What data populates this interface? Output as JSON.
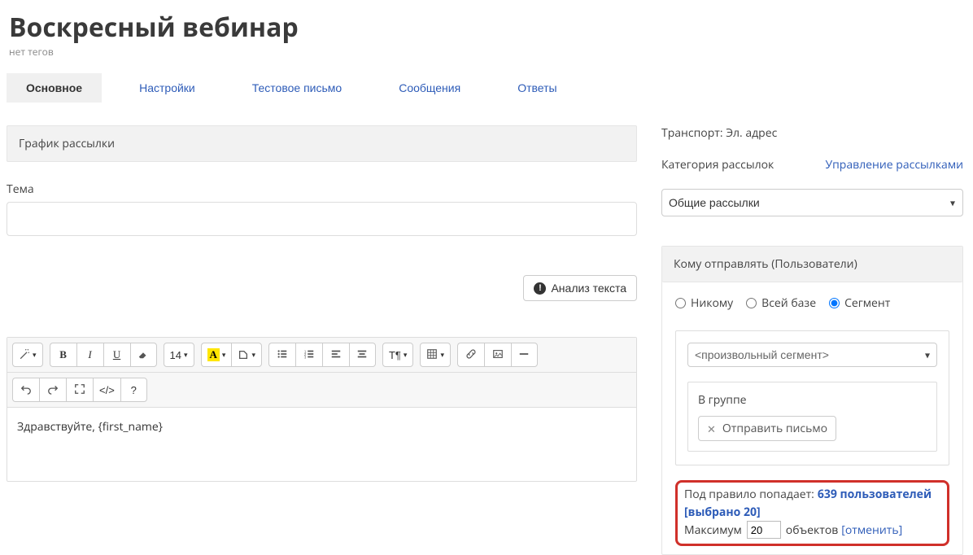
{
  "title": "Воскресный вебинар",
  "no_tags": "нет тегов",
  "tabs": {
    "main": "Основное",
    "settings": "Настройки",
    "test": "Тестовое письмо",
    "messages": "Сообщения",
    "answers": "Ответы"
  },
  "schedule_header": "График рассылки",
  "subject_label": "Тема",
  "subject_value": "",
  "analyze_label": "Анализ текста",
  "editor": {
    "fontsize": "14",
    "para": "T¶",
    "body": "Здравствуйте, {first_name}"
  },
  "side": {
    "transport": "Транспорт: Эл. адрес",
    "category_label": "Категория рассылок",
    "manage_link": "Управление рассылками",
    "category_value": "Общие рассылки",
    "recipients_header": "Кому отправлять (Пользователи)",
    "radio_none": "Никому",
    "radio_all": "Всей базе",
    "radio_segment": "Сегмент",
    "segment_value": "<произвольный сегмент>",
    "group_label": "В группе",
    "chip_label": "Отправить письмо",
    "rule_prefix": "Под правило попадает:",
    "rule_users": "639 пользователей",
    "rule_selected": "[выбрано 20]",
    "max_prefix": "Максимум",
    "max_value": "20",
    "max_objects": "объектов",
    "cancel": "[отменить]"
  }
}
